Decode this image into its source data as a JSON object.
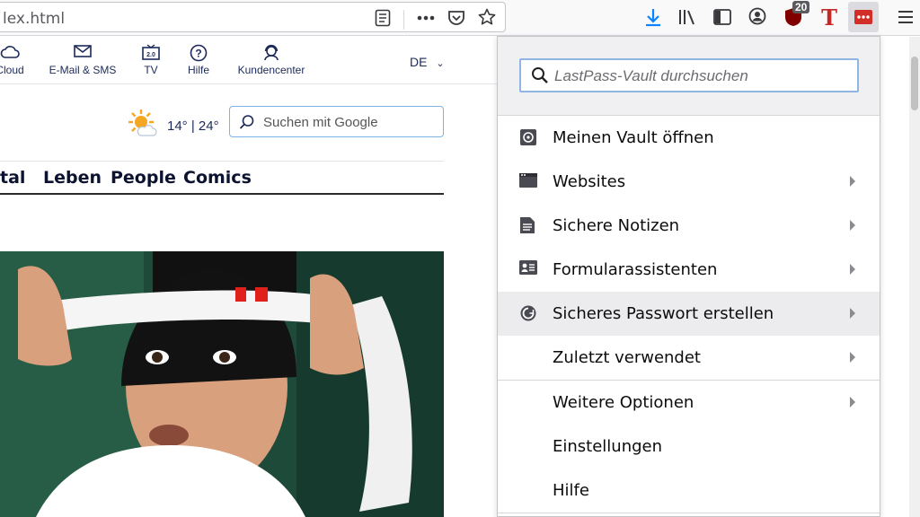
{
  "browser": {
    "url": "lex.html",
    "icons": [
      "reader-view-icon",
      "more-icon",
      "pocket-icon",
      "star-icon",
      "download-icon",
      "library-icon",
      "sidebar-icon",
      "account-icon",
      "ublock-icon",
      "t-extension-icon",
      "lastpass-icon",
      "hamburger-menu-icon"
    ],
    "ublock_badge": "20"
  },
  "page": {
    "services": [
      {
        "label": "Cloud",
        "icon": "cloud-icon"
      },
      {
        "label": "E-Mail & SMS",
        "icon": "mail-icon"
      },
      {
        "label": "TV",
        "icon": "tv-icon"
      },
      {
        "label": "Hilfe",
        "icon": "help-icon"
      },
      {
        "label": "Kundencenter",
        "icon": "customer-center-icon"
      }
    ],
    "language": "DE",
    "weather": {
      "temps": "14° | 24°",
      "icon": "sun-cloud-icon"
    },
    "search_placeholder": "Suchen mit Google",
    "nav": [
      "tal",
      "Leben",
      "People",
      "Comics"
    ]
  },
  "lastpass": {
    "search_placeholder": "LastPass-Vault durchsuchen",
    "items": [
      {
        "label": "Meinen Vault öffnen",
        "icon": "vault-icon",
        "submenu": false
      },
      {
        "label": "Websites",
        "icon": "websites-icon",
        "submenu": true
      },
      {
        "label": "Sichere Notizen",
        "icon": "notes-icon",
        "submenu": true
      },
      {
        "label": "Formularassistenten",
        "icon": "form-fill-icon",
        "submenu": true
      },
      {
        "label": "Sicheres Passwort erstellen",
        "icon": "password-generator-icon",
        "submenu": true
      },
      {
        "label": "Zuletzt verwendet",
        "icon": "",
        "submenu": true
      },
      {
        "label": "Weitere Optionen",
        "icon": "",
        "submenu": true
      },
      {
        "label": "Einstellungen",
        "icon": "",
        "submenu": false
      },
      {
        "label": "Hilfe",
        "icon": "",
        "submenu": false
      }
    ],
    "accent": "#d32d27"
  }
}
